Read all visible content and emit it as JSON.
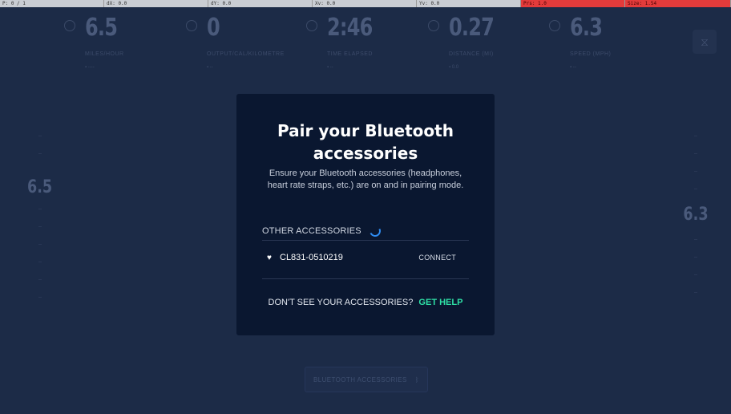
{
  "debug": {
    "cells": [
      "P: 0 / 1",
      "dX: 0.0",
      "dY: 0.0",
      "Xv: 0.0",
      "Yv: 0.0",
      "Prs: 1.0",
      "Size: 1.54"
    ]
  },
  "metrics": [
    {
      "value": "6.5",
      "label": "MILES/HOUR",
      "sub": "▪ ----"
    },
    {
      "value": "0",
      "label": "OUTPUT/CAL/KILOMETRE",
      "sub": "▪ --"
    },
    {
      "value": "2:46",
      "label": "TIME ELAPSED",
      "sub": "▪ --"
    },
    {
      "value": "0.27",
      "label": "DISTANCE (MI)",
      "sub": "▪ 0.0"
    },
    {
      "value": "6.3",
      "label": "SPEED (MPH)",
      "sub": "▪ --"
    }
  ],
  "side_left": {
    "ticks_top": [
      "--",
      "--"
    ],
    "value": "6.5",
    "ticks_bottom": [
      "--",
      "--",
      "--",
      "--",
      "--",
      "--"
    ]
  },
  "side_right": {
    "ticks_top": [
      "--",
      "--",
      "--",
      "--",
      "--"
    ],
    "value": "6.3",
    "ticks_bottom": [
      "--",
      "--",
      "--",
      "--",
      "--"
    ]
  },
  "bottom_button": {
    "label": "BLUETOOTH ACCESSORIES",
    "icon": "bluetooth-icon"
  },
  "modal": {
    "title": "Pair your Bluetooth accessories",
    "description": "Ensure your Bluetooth accessories (headphones, heart rate straps, etc.) are on and in pairing mode.",
    "section_label": "OTHER ACCESSORIES",
    "devices": [
      {
        "name": "CL831-0510219",
        "icon": "heart-rate-icon",
        "action": "CONNECT"
      }
    ],
    "help_text": "DON'T SEE YOUR ACCESSORIES?",
    "help_link": "GET HELP"
  },
  "colors": {
    "background": "#1c2b47",
    "modal": "#0a1730",
    "accent": "#2fe0a6",
    "spinner": "#2e8bf0"
  }
}
